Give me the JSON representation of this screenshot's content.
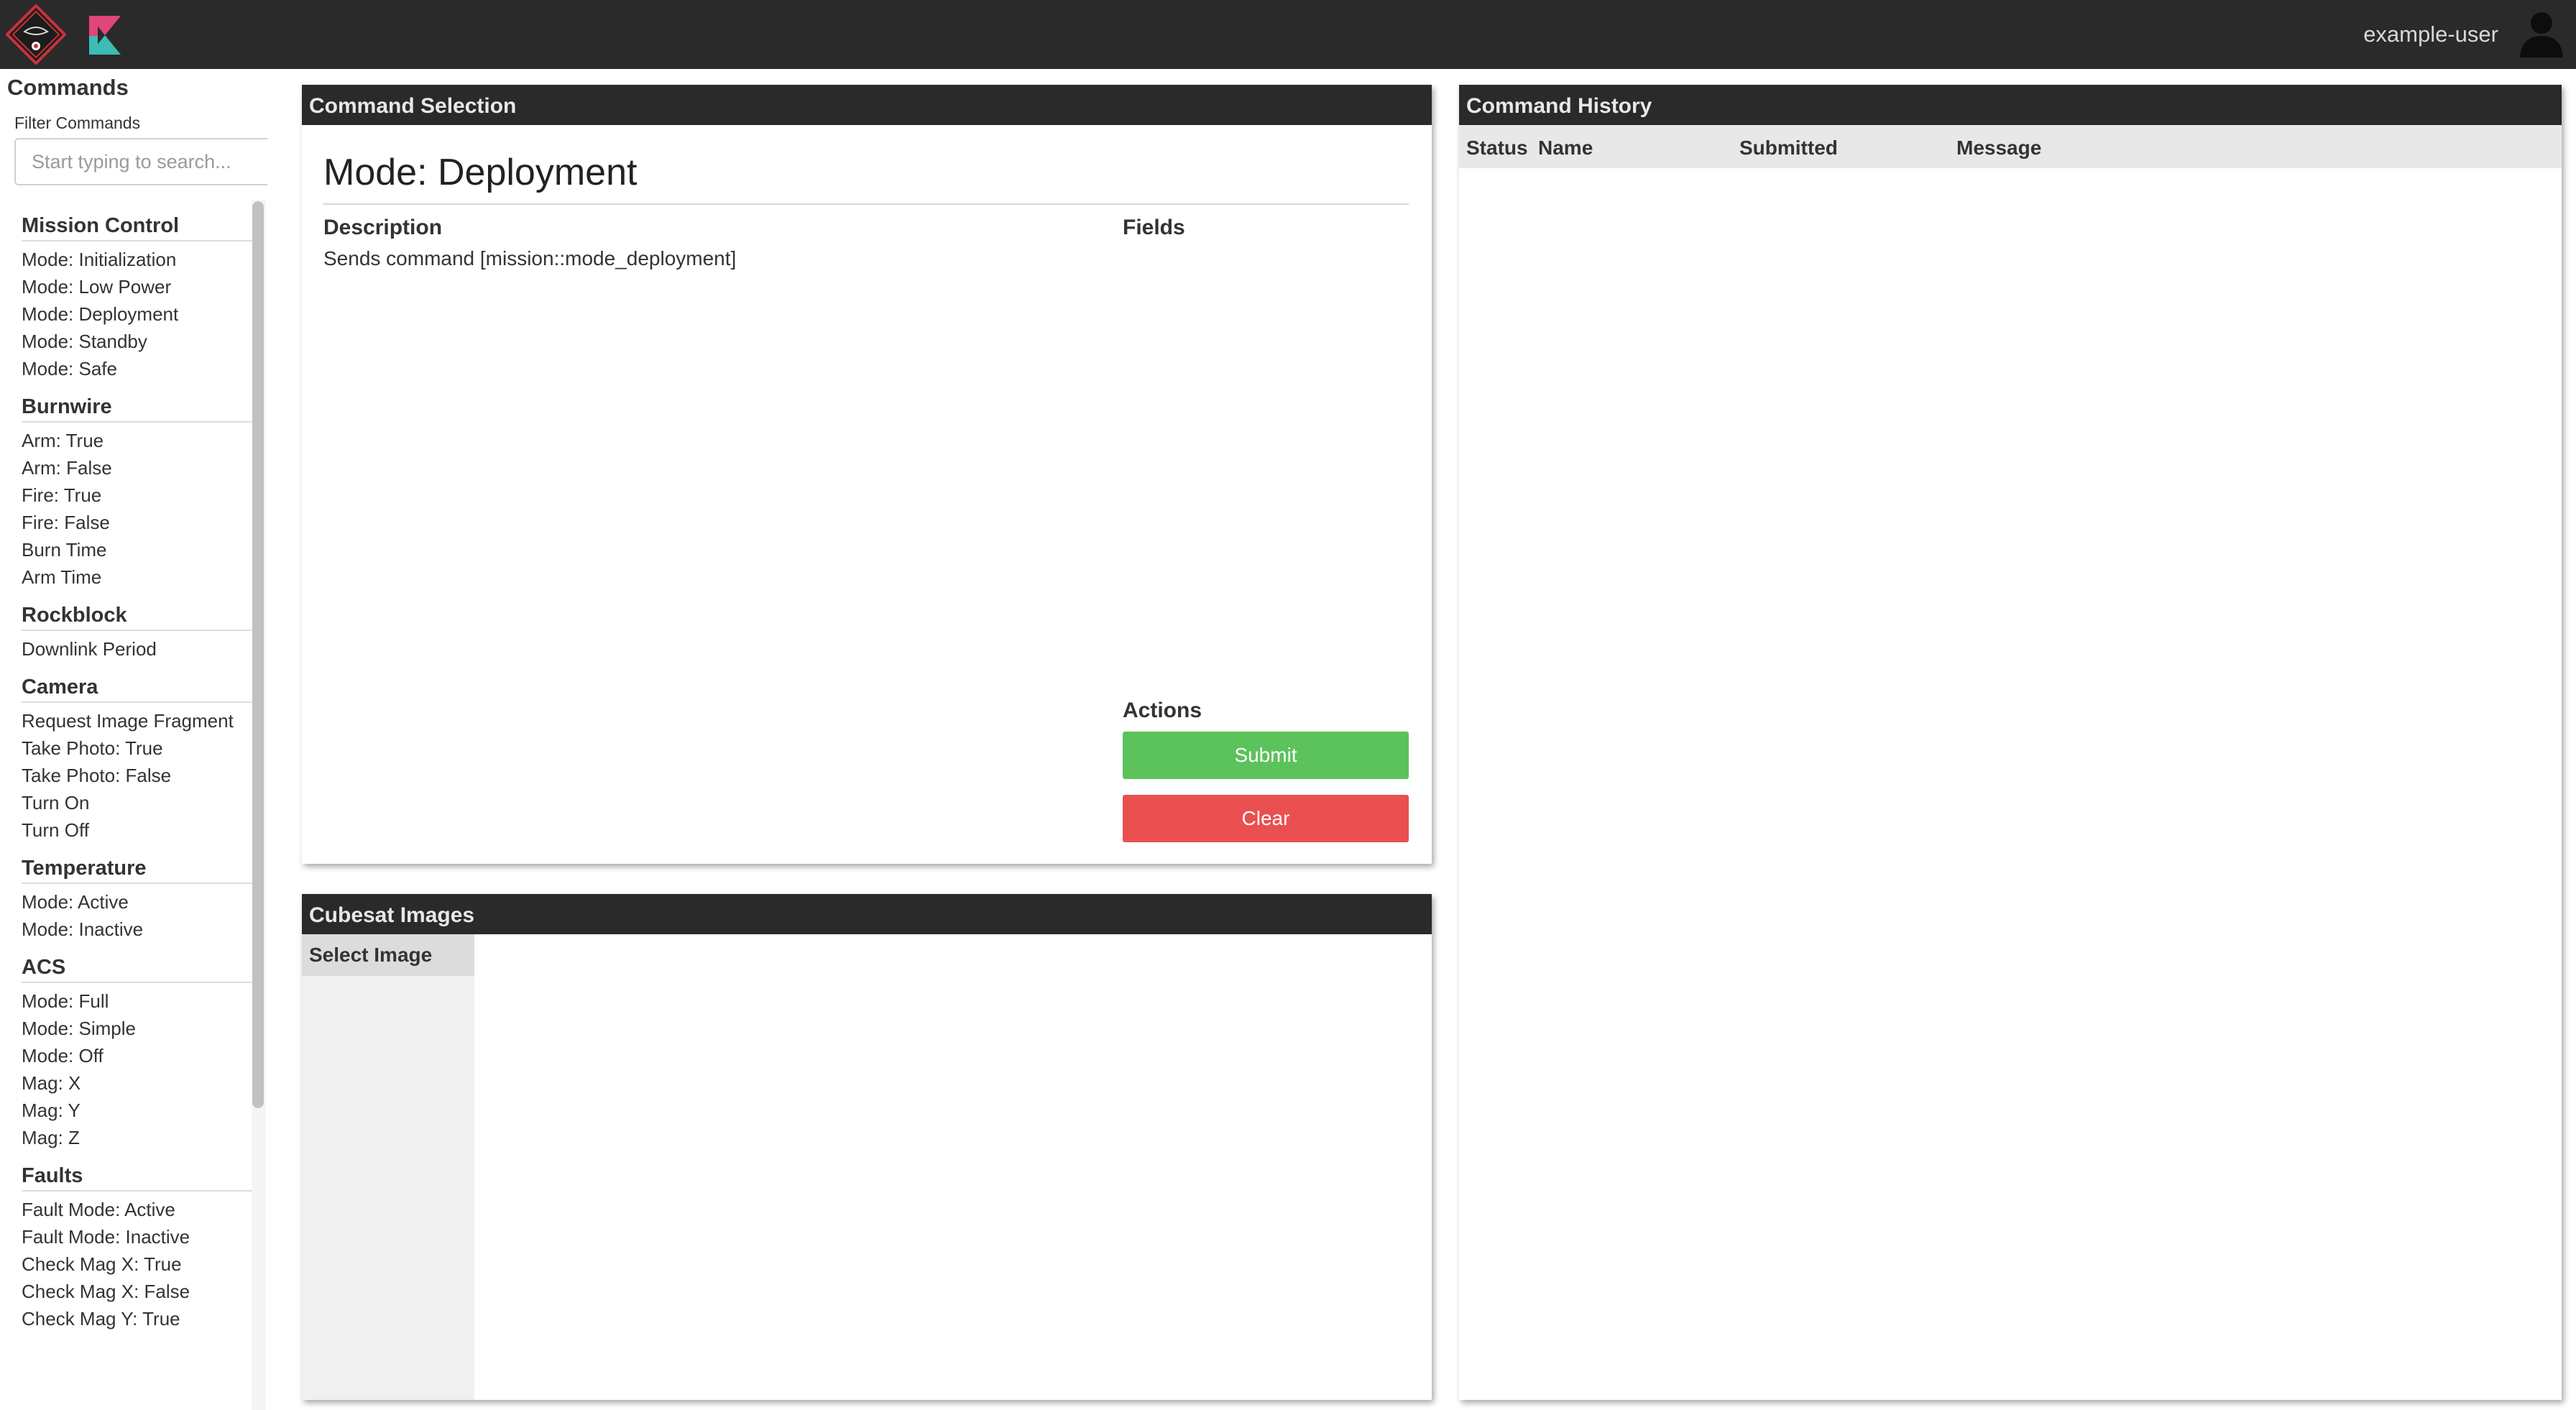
{
  "header": {
    "username": "example-user",
    "icons": {
      "mission_logo": "mission-logo",
      "app_logo": "kappa-logo",
      "user": "user-silhouette-icon"
    },
    "colors": {
      "bar": "#2a2a2b",
      "logo_red": "#c8323a",
      "logo_pink": "#e0457b",
      "logo_teal": "#3bbcb4"
    }
  },
  "sidebar": {
    "title": "Commands",
    "filter_label": "Filter Commands",
    "filter_placeholder": "Start typing to search...",
    "groups": [
      {
        "title": "Mission Control",
        "items": [
          "Mode: Initialization",
          "Mode: Low Power",
          "Mode: Deployment",
          "Mode: Standby",
          "Mode: Safe"
        ]
      },
      {
        "title": "Burnwire",
        "items": [
          "Arm: True",
          "Arm: False",
          "Fire: True",
          "Fire: False",
          "Burn Time",
          "Arm Time"
        ]
      },
      {
        "title": "Rockblock",
        "items": [
          "Downlink Period"
        ]
      },
      {
        "title": "Camera",
        "items": [
          "Request Image Fragment",
          "Take Photo: True",
          "Take Photo: False",
          "Turn On",
          "Turn Off"
        ]
      },
      {
        "title": "Temperature",
        "items": [
          "Mode: Active",
          "Mode: Inactive"
        ]
      },
      {
        "title": "ACS",
        "items": [
          "Mode: Full",
          "Mode: Simple",
          "Mode: Off",
          "Mag: X",
          "Mag: Y",
          "Mag: Z"
        ]
      },
      {
        "title": "Faults",
        "items": [
          "Fault Mode: Active",
          "Fault Mode: Inactive",
          "Check Mag X: True",
          "Check Mag X: False",
          "Check Mag Y: True"
        ]
      }
    ]
  },
  "command_selection": {
    "header": "Command Selection",
    "title": "Mode: Deployment",
    "description_label": "Description",
    "description": "Sends command [mission::mode_deployment]",
    "fields_label": "Fields",
    "actions_label": "Actions",
    "submit_label": "Submit",
    "clear_label": "Clear",
    "colors": {
      "submit": "#5cc25c",
      "clear": "#e9504f"
    }
  },
  "command_history": {
    "header": "Command History",
    "columns": [
      "Status",
      "Name",
      "Submitted",
      "Message"
    ],
    "rows": []
  },
  "cubesat_images": {
    "header": "Cubesat Images",
    "select_label": "Select Image"
  }
}
